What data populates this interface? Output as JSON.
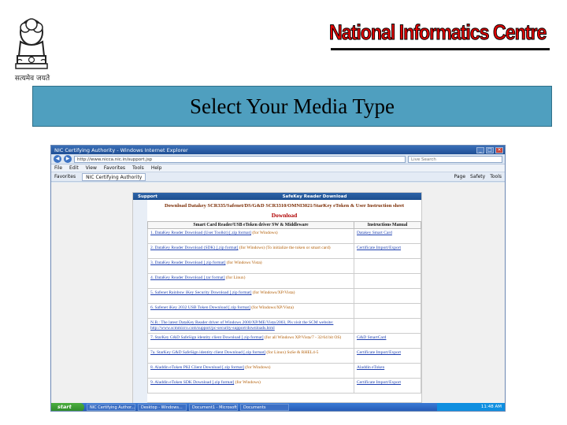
{
  "header": {
    "emblem_caption": "सत्यमेव जयते",
    "org_title": "National Informatics Centre"
  },
  "banner": {
    "title": "Select Your Media Type"
  },
  "browser": {
    "window_title": "NIC Certifying Authority - Windows Internet Explorer",
    "address": "http://www.nicca.nic.in/support.jsp",
    "search_placeholder": "Live Search",
    "menu": [
      "File",
      "Edit",
      "View",
      "Favorites",
      "Tools",
      "Help"
    ],
    "favorites_label": "Favorites",
    "tab_label": "NIC Certifying Authority",
    "tools": [
      "Page",
      "Safety",
      "Tools"
    ],
    "support_label": "Support",
    "page_header": "SafeKey Reader Download",
    "doc_heading": "Download Datakey SCR335/Safenet/DS/G&D SCR3310/OMNI3021/StarKey eToken & User Instruction sheet",
    "download_heading": "Download",
    "table_headers": [
      "Smart Card Reader/USB eToken driver SW & Middleware",
      "Instructions Manual"
    ],
    "rows": [
      {
        "left": "1. DataKey Reader Download (User Toolkit) [.zip format]",
        "note": "(for Windows)",
        "right": "Datakey Smart Card"
      },
      {
        "left": "2. DataKey Reader Download (SDK) [.zip format]",
        "note": "(for Windows) (To initialize the token or smart card)",
        "right": "Certificate Import/Export"
      },
      {
        "left": "3. DataKey Reader Download [.zip format]",
        "note": "(for Windows Vista)",
        "right": ""
      },
      {
        "left": "4. DataKey Reader Download [.tar format]",
        "note": "(for Linux)",
        "right": ""
      },
      {
        "left": "5. Safenet Rainbow iKey Security Download [.zip format]",
        "note": "(for Windows/XP/Vista)",
        "right": ""
      },
      {
        "left": "6. Safenet iKey 2032 USB Token Download [.zip format]",
        "note": "(for Windows/XP/Vista)",
        "right": ""
      },
      {
        "left": "N.B.: The latest DataKey Reader driver of Windows 2000/XP/ME/Vista/2003, Pls visit the SCM website: http://www.scmmicro.com/support/pc-security-support/downloads.html",
        "note": "",
        "right": ""
      },
      {
        "left": "7. StarKey G&D SafeSign identity client Download [.zip format]",
        "note": "(for all Windows XP/Vista/7 - 32/64 bit OS)",
        "right": "G&D SmartCard"
      },
      {
        "left": "7a. StarKey G&D SafeSign identity client Download [.zip format]",
        "note": "(for Linux) SuSe & RHEL4-5",
        "right": "Certificate Import/Export"
      },
      {
        "left": "8. Aladdin eToken PKI Client Download [.zip format]",
        "note": "(for Windows)",
        "right": "Aladdin eToken"
      },
      {
        "left": "9. Aladdin eToken SDK Download [.zip format]",
        "note": "(for Windows)",
        "right": "Certificate Import/Export"
      }
    ],
    "taskbar": {
      "start": "start",
      "tasks": [
        "NIC Certifying Author...",
        "Desktop - Windows...",
        "Document1 - Microsoft...",
        "Documents"
      ],
      "clock": "11:48 AM"
    }
  }
}
